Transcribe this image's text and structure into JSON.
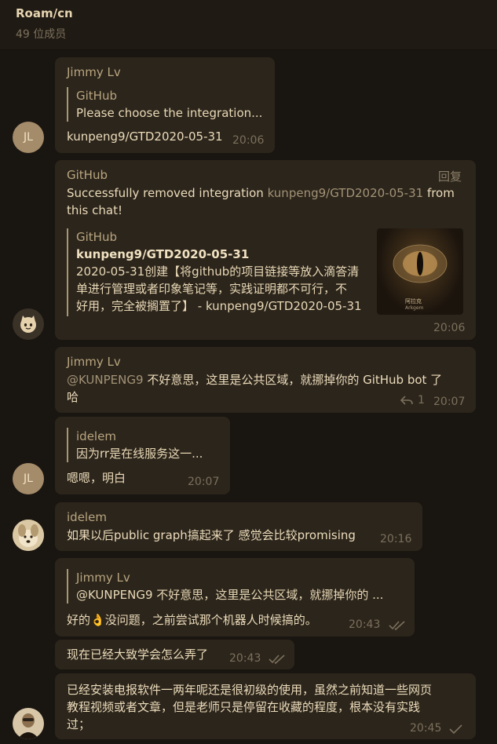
{
  "header": {
    "title": "Roam/cn",
    "subtitle": "49 位成员"
  },
  "messages": {
    "m1": {
      "sender": "Jimmy Lv",
      "quote_sender": "GitHub",
      "quote_text": "Please choose the integration...",
      "text": "kunpeng9/GTD2020-05-31",
      "time": "20:06",
      "avatar": "JL"
    },
    "m2": {
      "sender": "GitHub",
      "reply_label": "回复",
      "text_part1": "Successfully removed integration ",
      "text_link": "kunpeng9/GTD2020-05-31",
      "text_part2": " from",
      "text_line2": "this chat!",
      "card_sender": "GitHub",
      "card_title": "kunpeng9/GTD2020-05-31",
      "card_line1": "2020-05-31创建【将github的项目链接等放入滴答清",
      "card_line2": "单进行管理或者印象笔记等，实践证明都不可行，不",
      "card_line3": "好用，完全被搁置了】 - kunpeng9/GTD2020-05-31",
      "thumb_caption1": "阿拉克",
      "thumb_caption2": "Arkgem",
      "time": "20:06",
      "avatar_icon": "github-octocat-icon"
    },
    "m3": {
      "sender": "Jimmy Lv",
      "mention": "@KUNPENG9",
      "text_line1": " 不好意思，这里是公共区域，就挪掉你的 GitHub bot 了",
      "text_line2": "哈",
      "reply_count": "1",
      "time": "20:07"
    },
    "m4": {
      "quote_sender": "idelem",
      "quote_text": "因为rr是在线服务这一...",
      "text": "嗯嗯，明白",
      "time": "20:07",
      "avatar": "JL"
    },
    "m5": {
      "sender": "idelem",
      "text": "如果以后public graph搞起来了 感觉会比较promising",
      "time": "20:16"
    },
    "m6": {
      "quote_sender": "Jimmy Lv",
      "quote_text": "@KUNPENG9 不好意思，这里是公共区域，就挪掉你的 ...",
      "text_before": "好的",
      "emoji": "👌",
      "text_after": "没问题，之前尝试那个机器人时候搞的。",
      "time": "20:43"
    },
    "m7": {
      "text": "现在已经大致学会怎么弄了",
      "time": "20:43"
    },
    "m8": {
      "line1": "已经安装电报软件一两年呢还是很初级的使用，虽然之前知道一些网页",
      "line2": "教程视频或者文章，但是老师只是停留在收藏的程度，根本没有实践",
      "line3": "过；",
      "time": "20:45"
    }
  },
  "colors": {
    "background": "#191510",
    "bubble": "#2c251b",
    "accent": "#a39377"
  }
}
